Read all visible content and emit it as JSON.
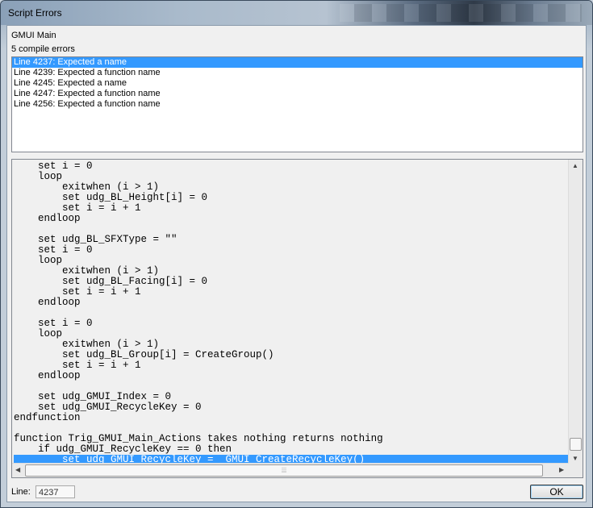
{
  "window": {
    "title": "Script Errors"
  },
  "header": {
    "trigger_name": "GMUI Main",
    "error_count": "5 compile errors"
  },
  "errors": [
    {
      "text": "Line 4237: Expected a name",
      "selected": true
    },
    {
      "text": "Line 4239: Expected a function name",
      "selected": false
    },
    {
      "text": "Line 4245: Expected a name",
      "selected": false
    },
    {
      "text": "Line 4247: Expected a function name",
      "selected": false
    },
    {
      "text": "Line 4256: Expected a function name",
      "selected": false
    }
  ],
  "code": {
    "lines": [
      "    set i = 0",
      "    loop",
      "        exitwhen (i > 1)",
      "        set udg_BL_Height[i] = 0",
      "        set i = i + 1",
      "    endloop",
      "",
      "    set udg_BL_SFXType = \"\"",
      "    set i = 0",
      "    loop",
      "        exitwhen (i > 1)",
      "        set udg_BL_Facing[i] = 0",
      "        set i = i + 1",
      "    endloop",
      "",
      "    set i = 0",
      "    loop",
      "        exitwhen (i > 1)",
      "        set udg_BL_Group[i] = CreateGroup()",
      "        set i = i + 1",
      "    endloop",
      "",
      "    set udg_GMUI_Index = 0",
      "    set udg_GMUI_RecycleKey = 0",
      "endfunction",
      "",
      "function Trig_GMUI_Main_Actions takes nothing returns nothing",
      "    if udg_GMUI_RecycleKey == 0 then",
      "        set udg_GMUI_RecycleKey =  GMUI_CreateRecycleKey()"
    ],
    "selected_line_index": 28
  },
  "footer": {
    "line_label": "Line:",
    "line_value": "4237",
    "ok_label": "OK"
  },
  "colors": {
    "selection": "#3399ff"
  },
  "icons": {
    "scroll_up": "triangle-up-icon",
    "scroll_down": "triangle-down-icon",
    "scroll_left": "triangle-left-icon",
    "scroll_right": "triangle-right-icon",
    "grip": "grip-icon"
  }
}
